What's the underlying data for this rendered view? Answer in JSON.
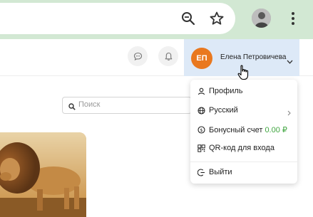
{
  "header": {
    "avatar_initials": "ЕП",
    "user_name": "Елена Петровичева",
    "avatar_color": "#e9781f"
  },
  "search": {
    "placeholder": "Поиск"
  },
  "menu": {
    "items": [
      {
        "label": "Профиль",
        "icon": "person-icon"
      },
      {
        "label": "Русский",
        "icon": "globe-icon"
      },
      {
        "label": "Бонусный счет",
        "value": "0.00 ₽",
        "icon": "coin-icon"
      },
      {
        "label": "QR-код для входа",
        "icon": "qr-icon"
      },
      {
        "label": "Выйти",
        "icon": "logout-icon"
      }
    ]
  },
  "colors": {
    "chrome_bg": "#d2e8d3",
    "user_area_bg": "#dde9f7",
    "bonus_value": "#3fa53f"
  }
}
